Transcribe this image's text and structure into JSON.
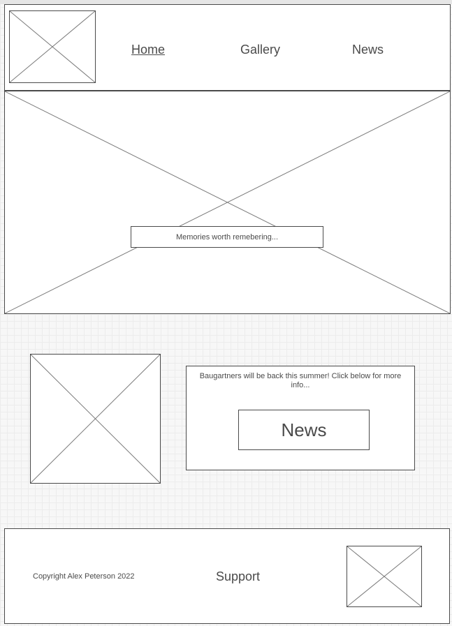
{
  "header": {
    "nav": [
      {
        "label": "Home",
        "active": true
      },
      {
        "label": "Gallery",
        "active": false
      },
      {
        "label": "News",
        "active": false
      }
    ]
  },
  "hero": {
    "tagline": "Memories worth remebering..."
  },
  "promo": {
    "text": "Baugartners will be back this summer! Click below for more info...",
    "button_label": "News"
  },
  "footer": {
    "copyright": "Copyright Alex Peterson 2022",
    "support_label": "Support"
  },
  "icons": {
    "logo": "image-placeholder-icon",
    "hero": "image-placeholder-icon",
    "promo": "image-placeholder-icon",
    "footer": "image-placeholder-icon"
  },
  "colors": {
    "stroke": "#4a4a4a",
    "text": "#4a4a4a",
    "grid": "#ececec"
  }
}
